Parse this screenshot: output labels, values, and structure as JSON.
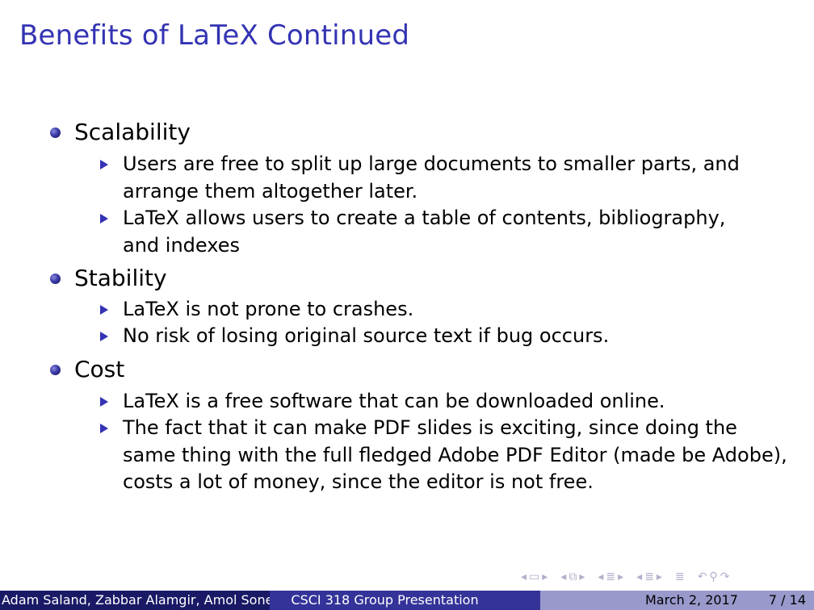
{
  "slide": {
    "title": "Benefits of LaTeX Continued",
    "sections": [
      {
        "heading": "Scalability",
        "items": [
          "Users are free to split up large documents to smaller parts, and arrange them altogether later.",
          "LaTeX allows users to create a table of contents, bibliography, and indexes"
        ]
      },
      {
        "heading": "Stability",
        "items": [
          "LaTeX is not prone to crashes.",
          "No risk of losing original source text if bug occurs."
        ]
      },
      {
        "heading": "Cost",
        "items": [
          "LaTeX is a free software that can be downloaded online.",
          "The fact that it can make PDF slides is exciting, since doing the same thing with the full fledged Adobe PDF Editor (made be Adobe), costs a lot of money, since the editor is not free."
        ]
      }
    ]
  },
  "footer": {
    "authors": "Adam Saland, Zabbar Alamgir, Amol Soneji,",
    "presentation": "CSCI 318 Group Presentation",
    "date": "March 2, 2017",
    "page": "7 / 14"
  },
  "navigation": {
    "icons": [
      "frame-prev-icon",
      "frame-icon",
      "frame-next-icon",
      "subsection-prev-icon",
      "subsection-icon",
      "subsection-next-icon",
      "section-prev-icon",
      "section-icon",
      "section-next-icon",
      "doc-prev-icon",
      "doc-icon",
      "doc-next-icon",
      "appendix-icon",
      "search-icon",
      "back-icon",
      "forward-icon"
    ]
  },
  "colors": {
    "title": "#3333b3",
    "footer_dark": "#191966",
    "footer_mid": "#333399",
    "footer_light": "#9999cc"
  }
}
